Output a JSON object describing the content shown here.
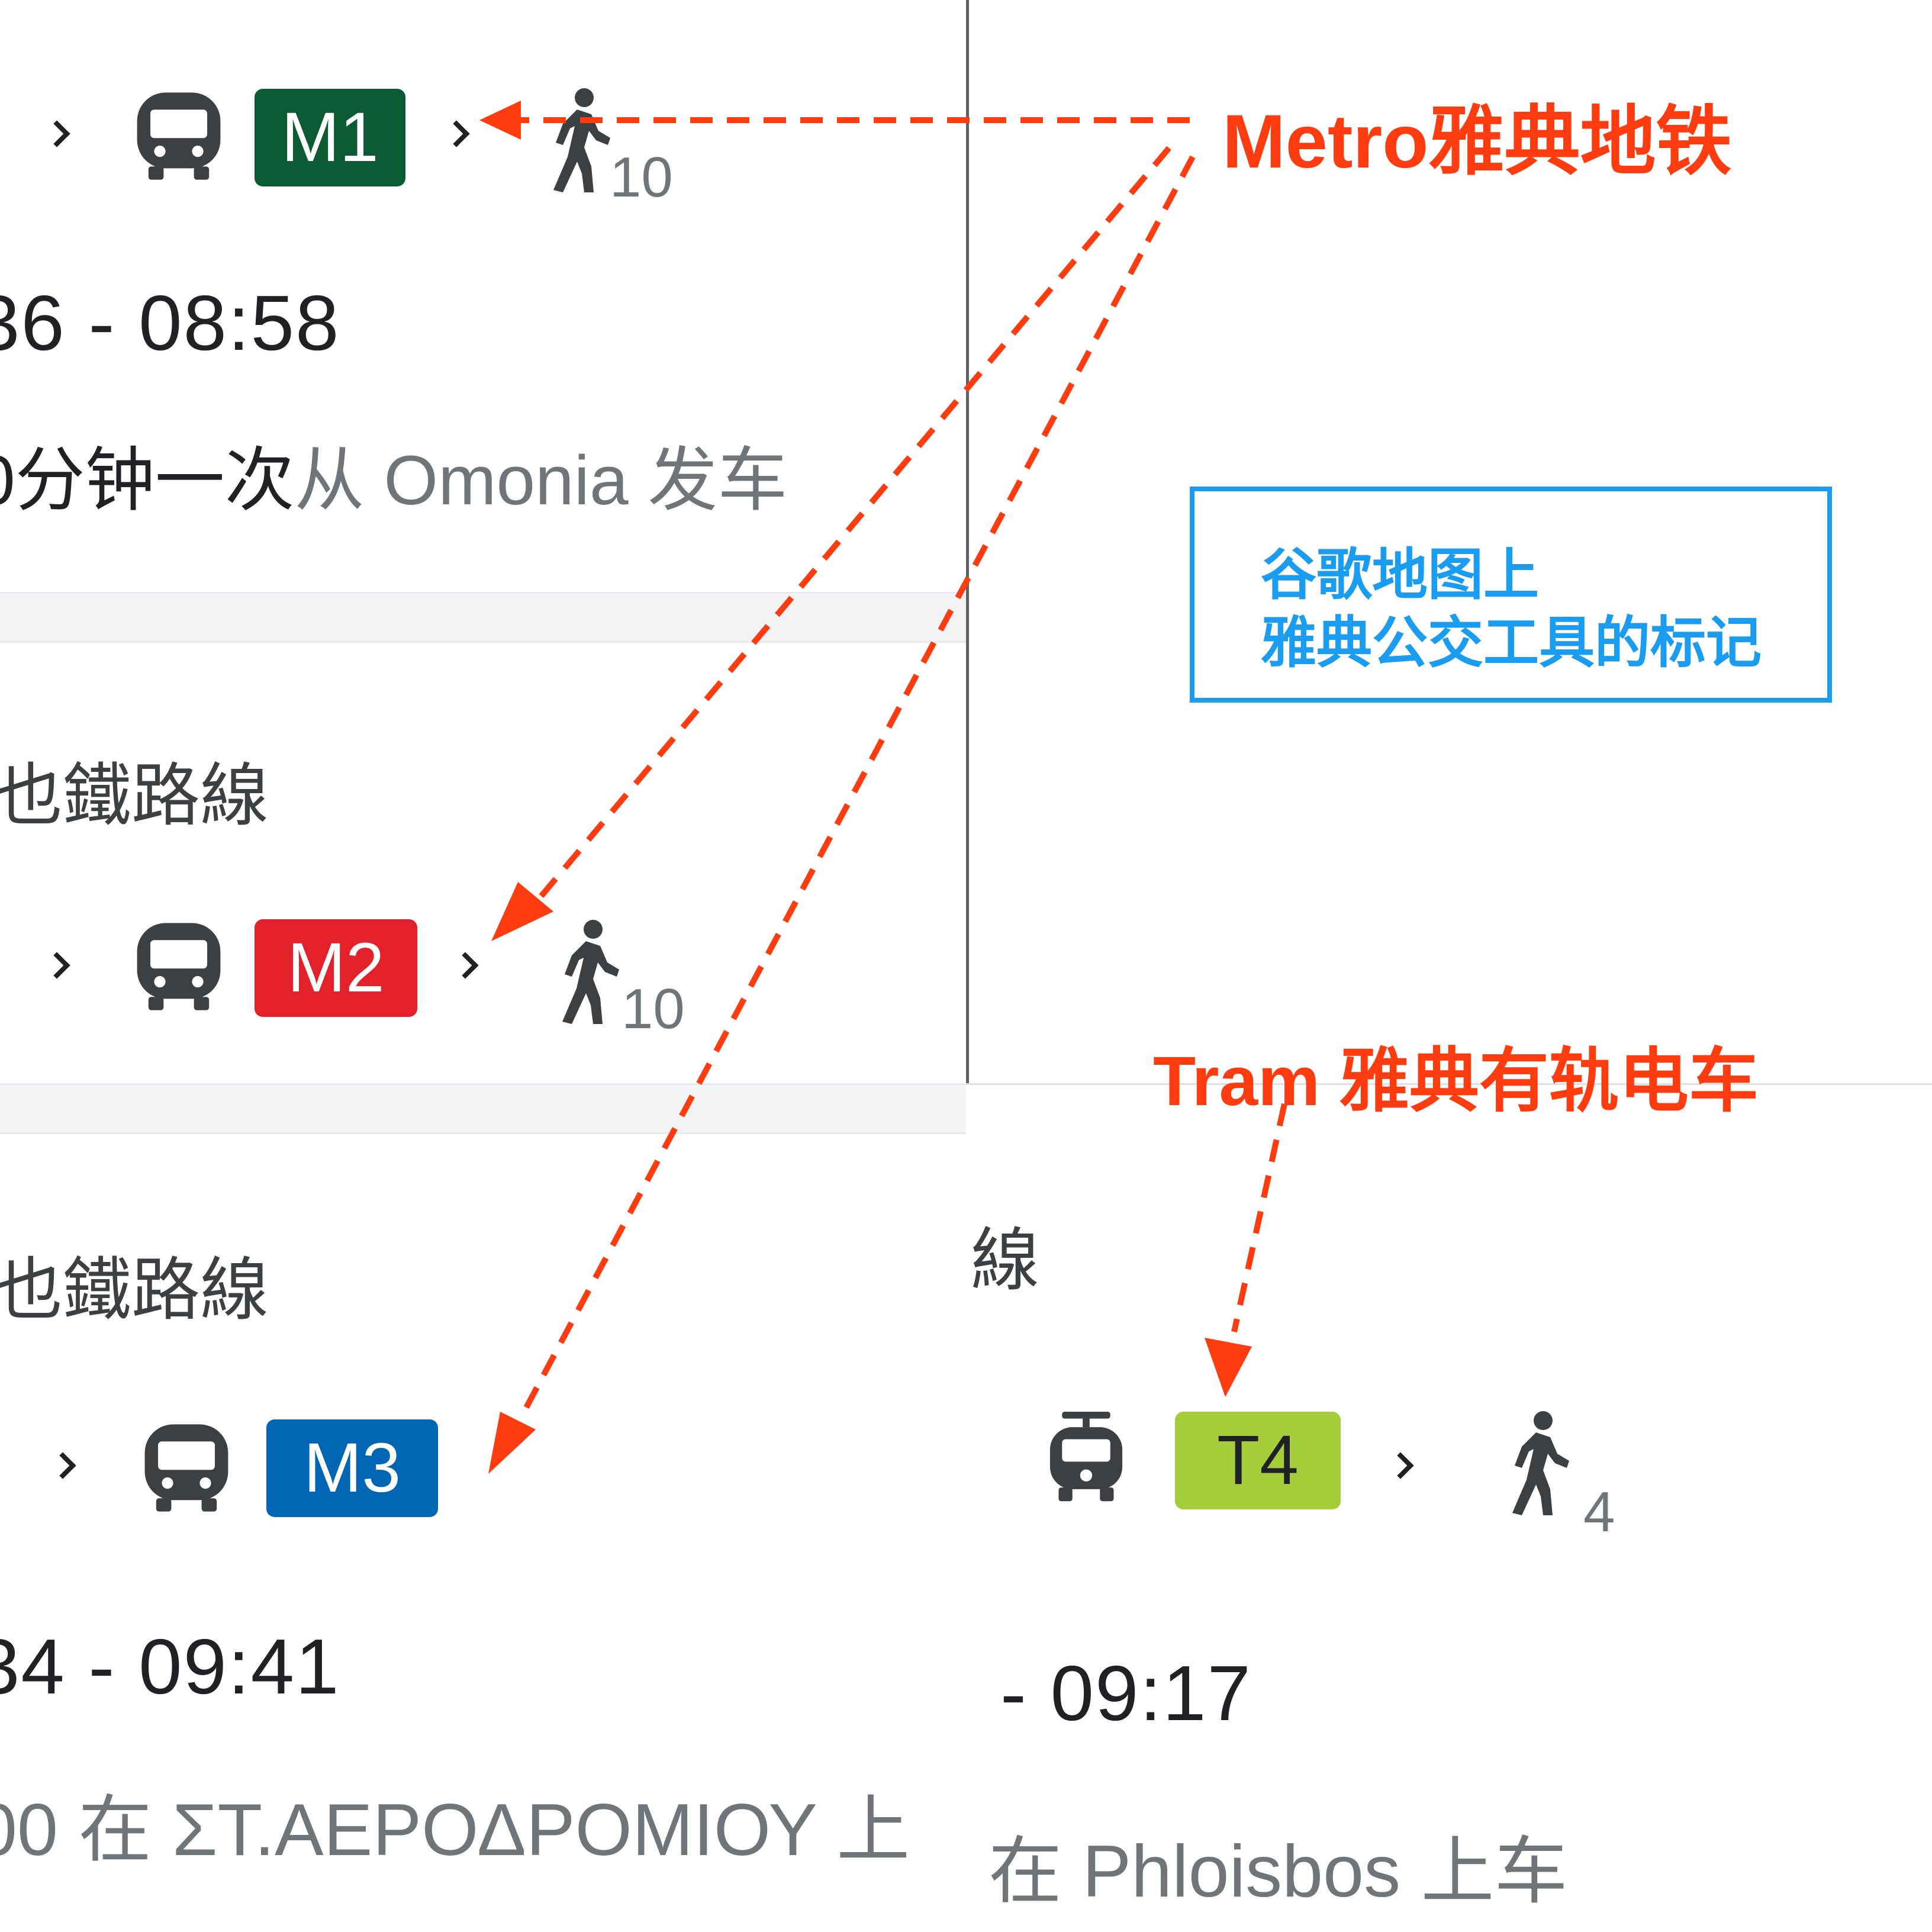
{
  "colors": {
    "m1": "#0b5a33",
    "m2": "#e2212b",
    "m3": "#0066b3",
    "t4": "#a5cd39",
    "annotation": "#ff3b10",
    "info": "#1a9cf0"
  },
  "routes": {
    "m1": {
      "badge": "M1",
      "walk_minutes": "10",
      "time": "36 - 08:58",
      "freq_prefix": "0分钟一次",
      "freq_suffix": "从 Omonia 发车"
    },
    "m2": {
      "label": "也鐵路線",
      "badge": "M2",
      "walk_minutes": "10"
    },
    "m3": {
      "label": "也鐵路線",
      "badge": "M3",
      "time": "34 - 09:41",
      "board": "00 在 ΣΤ.ΑΕΡΟΔΡΟΜΙΟΥ 上"
    },
    "t4": {
      "label": "線",
      "badge": "T4",
      "walk_minutes": "4",
      "time": "- 09:17",
      "board": "在 Phloisbos 上车"
    }
  },
  "icons": {
    "bus": "bus-icon",
    "tram": "tram-icon",
    "walk": "walk-icon",
    "chevron": "chevron-right-icon"
  },
  "annotations": {
    "metro": "Metro雅典地铁",
    "tram": "Tram 雅典有轨电车",
    "info_line1": "谷歌地图上",
    "info_line2": "雅典公交工具的标记"
  }
}
